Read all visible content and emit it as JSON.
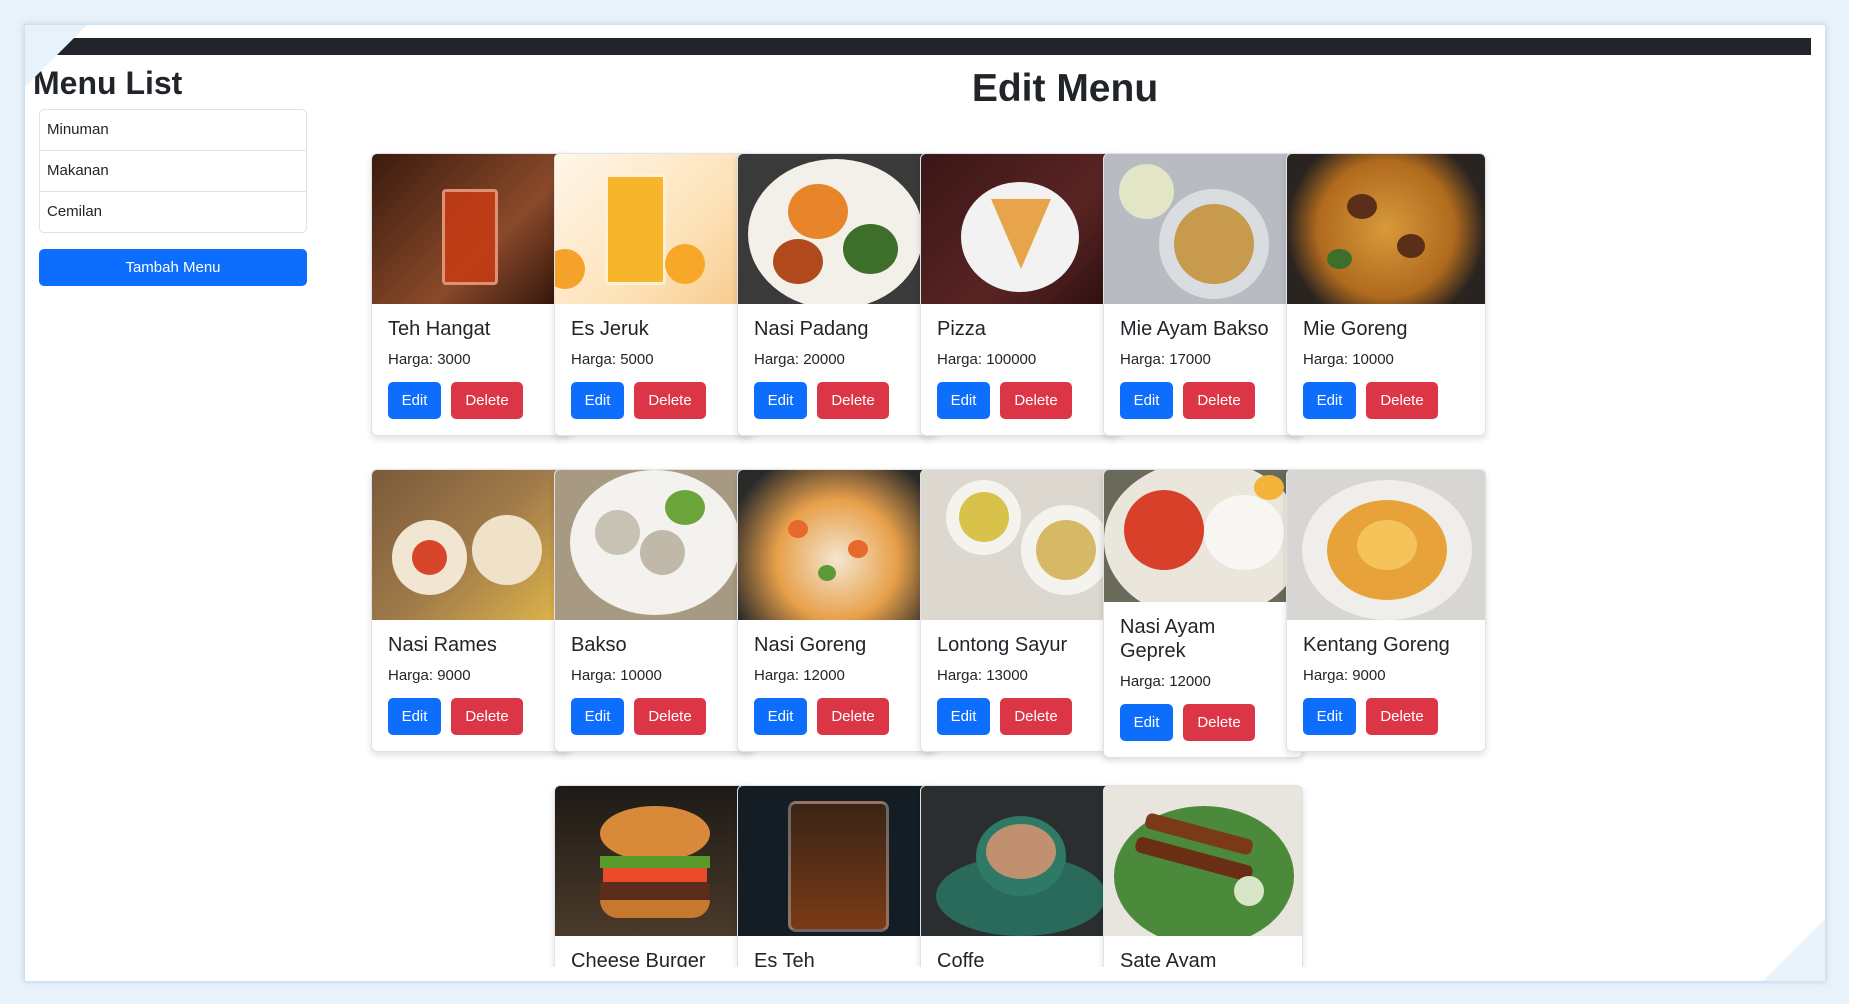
{
  "sidebar": {
    "title": "Menu List",
    "categories": [
      "Minuman",
      "Makanan",
      "Cemilan"
    ],
    "add_button": "Tambah Menu"
  },
  "main": {
    "title": "Edit Menu",
    "edit_label": "Edit",
    "delete_label": "Delete",
    "items": [
      {
        "name": "Teh Hangat",
        "price": "Harga: 3000"
      },
      {
        "name": "Es Jeruk",
        "price": "Harga: 5000"
      },
      {
        "name": "Nasi Padang",
        "price": "Harga: 20000"
      },
      {
        "name": "Pizza",
        "price": "Harga: 100000"
      },
      {
        "name": "Mie Ayam Bakso",
        "price": "Harga: 17000"
      },
      {
        "name": "Mie Goreng",
        "price": "Harga: 10000"
      },
      {
        "name": "Nasi Rames",
        "price": "Harga: 9000"
      },
      {
        "name": "Bakso",
        "price": "Harga: 10000"
      },
      {
        "name": "Nasi Goreng",
        "price": "Harga: 12000"
      },
      {
        "name": "Lontong Sayur",
        "price": "Harga: 13000"
      },
      {
        "name": "Nasi Ayam Geprek",
        "price": "Harga: 12000"
      },
      {
        "name": "Kentang Goreng",
        "price": "Harga: 9000"
      },
      {
        "name": "Cheese Burger"
      },
      {
        "name": "Es Teh"
      },
      {
        "name": "Coffe"
      },
      {
        "name": "Sate Ayam"
      }
    ]
  },
  "colors": {
    "primary": "#0d6efd",
    "danger": "#dc3545",
    "navbar": "#212529"
  }
}
